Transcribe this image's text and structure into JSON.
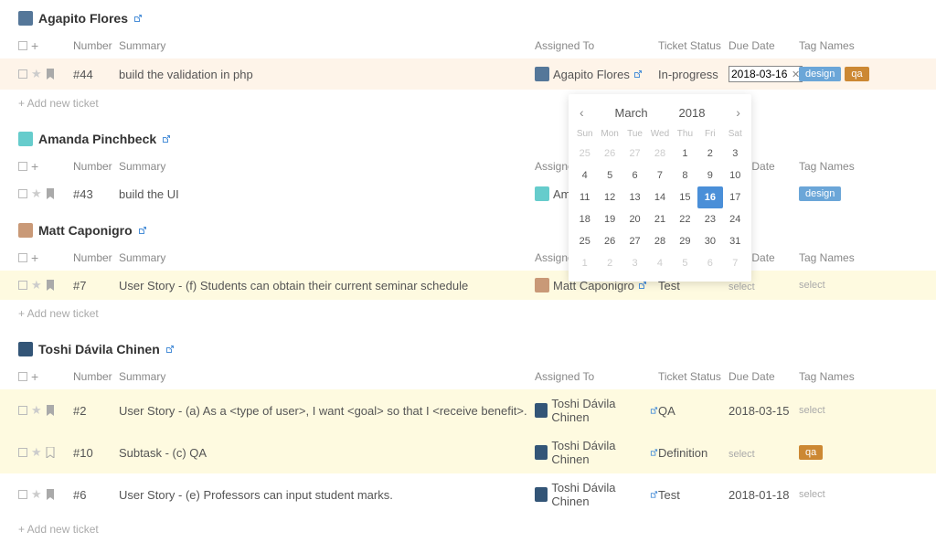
{
  "headers": {
    "number": "Number",
    "summary": "Summary",
    "assigned_to": "Assigned To",
    "ticket_status": "Ticket Status",
    "due_date": "Due Date",
    "tag_names": "Tag Names"
  },
  "add_new_ticket": "+ Add new ticket",
  "tags": {
    "design": "design",
    "qa": "qa"
  },
  "placeholders": {
    "select": "select"
  },
  "groups": [
    {
      "name": "Agapito Flores",
      "avatar_class": "avatar-ag",
      "add_link": true,
      "rows": [
        {
          "highlight": "highlight-orange",
          "number": "#44",
          "summary": "build the validation in php",
          "assigned_name": "Agapito Flores",
          "assigned_avatar": "avatar-ag",
          "ext": true,
          "status": "In-progress",
          "due_input_value": "2018-03-16",
          "tags": [
            {
              "text": "design",
              "cls": "tag-blue"
            },
            {
              "text": "qa",
              "cls": "tag-orange"
            }
          ]
        }
      ]
    },
    {
      "name": "Amanda Pinchbeck",
      "avatar_class": "avatar-ap",
      "add_link": false,
      "rows": [
        {
          "highlight": "",
          "number": "#43",
          "summary": "build the UI",
          "assigned_name": "Amanda Pinc",
          "assigned_avatar": "avatar-ap",
          "ext": false,
          "status": "",
          "due": "",
          "tags": [
            {
              "text": "design",
              "cls": "tag-blue"
            }
          ]
        }
      ]
    },
    {
      "name": "Matt Caponigro",
      "avatar_class": "avatar-mc",
      "add_link": true,
      "rows": [
        {
          "highlight": "highlight-yellow",
          "number": "#7",
          "summary": "User Story - (f) Students can obtain their current seminar schedule",
          "assigned_name": "Matt Caponigro",
          "assigned_avatar": "avatar-mc",
          "ext": true,
          "status": "Test",
          "due_select": true,
          "tag_select": true
        }
      ]
    },
    {
      "name": "Toshi Dávila Chinen",
      "avatar_class": "avatar-td",
      "add_link": true,
      "rows": [
        {
          "highlight": "highlight-yellow",
          "number": "#2",
          "summary": "User Story - (a) As a <type of user>, I want <goal> so that I <receive benefit>.",
          "assigned_name": "Toshi Dávila Chinen",
          "assigned_avatar": "avatar-td",
          "ext": true,
          "status": "QA",
          "due": "2018-03-15",
          "tag_select": true
        },
        {
          "highlight": "highlight-yellow",
          "number": "#10",
          "summary": "Subtask - (c) QA",
          "assigned_name": "Toshi Dávila Chinen",
          "assigned_avatar": "avatar-td",
          "ext": true,
          "status": "Definition",
          "due_select": true,
          "tags": [
            {
              "text": "qa",
              "cls": "tag-orange"
            }
          ],
          "bookmark_outline": true
        },
        {
          "highlight": "",
          "number": "#6",
          "summary": "User Story - (e) Professors can input student marks.",
          "assigned_name": "Toshi Dávila Chinen",
          "assigned_avatar": "avatar-td",
          "ext": true,
          "status": "Test",
          "due": "2018-01-18",
          "tag_select": true
        }
      ]
    }
  ],
  "datepicker": {
    "month": "March",
    "year": "2018",
    "dow": [
      "Sun",
      "Mon",
      "Tue",
      "Wed",
      "Thu",
      "Fri",
      "Sat"
    ],
    "weeks": [
      [
        {
          "d": "25",
          "m": true
        },
        {
          "d": "26",
          "m": true
        },
        {
          "d": "27",
          "m": true
        },
        {
          "d": "28",
          "m": true
        },
        {
          "d": "1"
        },
        {
          "d": "2"
        },
        {
          "d": "3"
        }
      ],
      [
        {
          "d": "4"
        },
        {
          "d": "5"
        },
        {
          "d": "6"
        },
        {
          "d": "7"
        },
        {
          "d": "8"
        },
        {
          "d": "9"
        },
        {
          "d": "10"
        }
      ],
      [
        {
          "d": "11"
        },
        {
          "d": "12"
        },
        {
          "d": "13"
        },
        {
          "d": "14"
        },
        {
          "d": "15"
        },
        {
          "d": "16",
          "sel": true
        },
        {
          "d": "17"
        }
      ],
      [
        {
          "d": "18"
        },
        {
          "d": "19"
        },
        {
          "d": "20"
        },
        {
          "d": "21"
        },
        {
          "d": "22"
        },
        {
          "d": "23"
        },
        {
          "d": "24"
        }
      ],
      [
        {
          "d": "25"
        },
        {
          "d": "26"
        },
        {
          "d": "27"
        },
        {
          "d": "28"
        },
        {
          "d": "29"
        },
        {
          "d": "30"
        },
        {
          "d": "31"
        }
      ],
      [
        {
          "d": "1",
          "m": true
        },
        {
          "d": "2",
          "m": true
        },
        {
          "d": "3",
          "m": true
        },
        {
          "d": "4",
          "m": true
        },
        {
          "d": "5",
          "m": true
        },
        {
          "d": "6",
          "m": true
        },
        {
          "d": "7",
          "m": true
        }
      ]
    ]
  }
}
